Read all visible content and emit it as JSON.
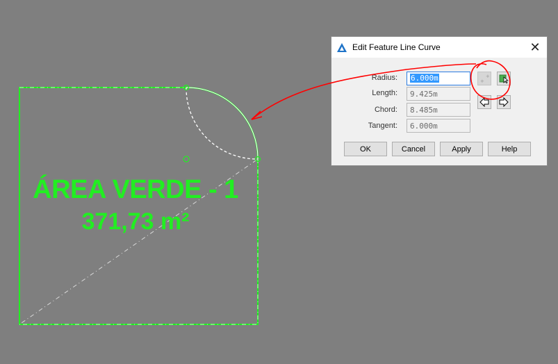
{
  "drawing": {
    "area_name": "ÁREA VERDE - 1",
    "area_value": "371,73 m²",
    "linework_color": "#22ee22"
  },
  "dialog": {
    "title": "Edit Feature Line Curve",
    "close_glyph": "✕",
    "fields": {
      "radius_label": "Radius:",
      "radius_value": "6.000m",
      "length_label": "Length:",
      "length_value": "9.425m",
      "chord_label": "Chord:",
      "chord_value": "8.485m",
      "tangent_label": "Tangent:",
      "tangent_value": "6.000m"
    },
    "buttons": {
      "ok": "OK",
      "cancel": "Cancel",
      "apply": "Apply",
      "help": "Help"
    },
    "icons": [
      "autocad-app-icon",
      "pick-point-icon",
      "pick-from-drawing-icon",
      "arrow-left-icon",
      "arrow-right-icon"
    ]
  },
  "annotation_color": "#ff0000"
}
